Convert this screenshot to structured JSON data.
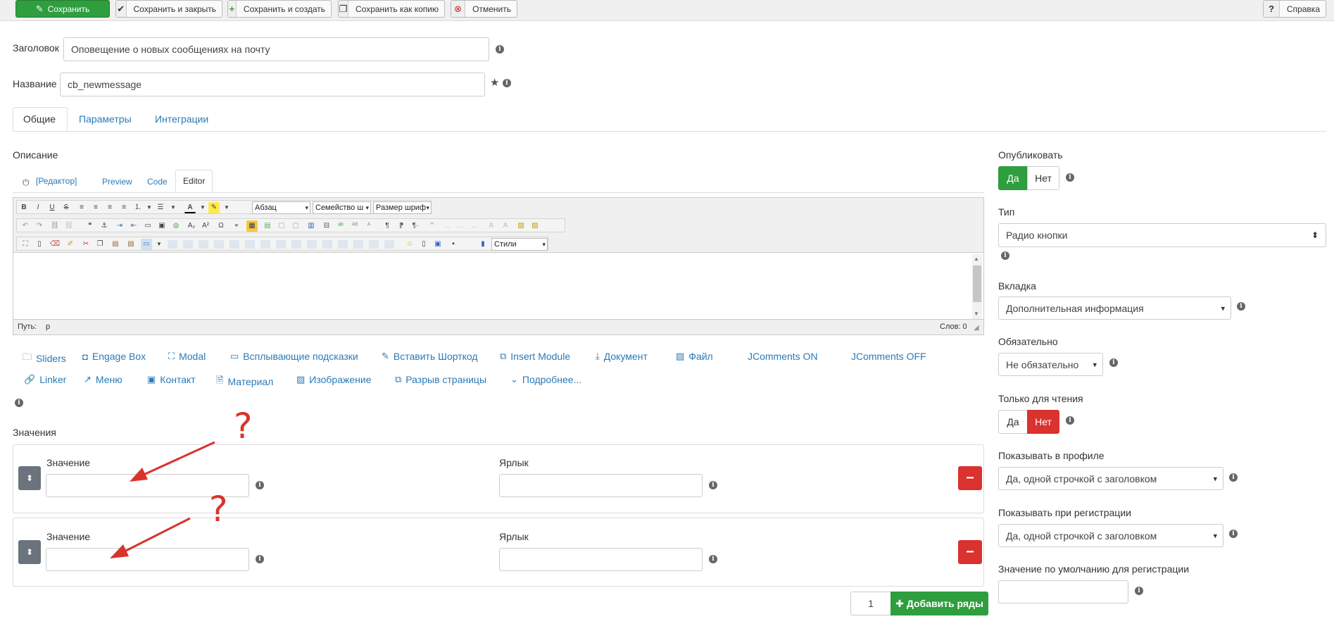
{
  "toolbar": {
    "save": "Сохранить",
    "save_close": "Сохранить и закрыть",
    "save_new": "Сохранить и создать",
    "save_copy": "Сохранить как копию",
    "cancel": "Отменить",
    "help": "Справка"
  },
  "fields": {
    "title_label": "Заголовок",
    "title_value": "Оповещение о новых сообщениях на почту",
    "name_label": "Название",
    "name_value": "cb_newmessage"
  },
  "tabs": [
    "Общие",
    "Параметры",
    "Интеграции"
  ],
  "editor": {
    "description_label": "Описание",
    "toggle_label": "[Редактор]",
    "modes": [
      "Preview",
      "Code",
      "Editor"
    ],
    "format_select": "Абзац",
    "font_family_select": "Семейство ш",
    "font_size_select": "Размер шриф",
    "styles_select": "Стили",
    "path_label": "Путь:",
    "path_value": "p",
    "word_count": "Слов: 0"
  },
  "plugin_buttons": [
    "Sliders",
    "Engage Box",
    "Modal",
    "Всплывающие подсказки",
    "Вставить Шорткод",
    "Insert Module",
    "Документ",
    "Файл",
    "JComments ON",
    "JComments OFF",
    "Linker",
    "Меню",
    "Контакт",
    "Материал",
    "Изображение",
    "Разрыв страницы",
    "Подробнее..."
  ],
  "values": {
    "section_label": "Значения",
    "value_label": "Значение",
    "label_label": "Ярлык",
    "rows": [
      {
        "value": "",
        "label": ""
      },
      {
        "value": "",
        "label": ""
      }
    ],
    "row_count": "1",
    "add_rows_button": "Добавить ряды",
    "annotation": "?"
  },
  "sidebar": {
    "publish_label": "Опубликовать",
    "yes": "Да",
    "no": "Нет",
    "type_label": "Тип",
    "type_value": "Радио кнопки",
    "tab_label": "Вкладка",
    "tab_value": "Дополнительная информация",
    "required_label": "Обязательно",
    "required_value": "Не обязательно",
    "readonly_label": "Только для чтения",
    "profile_label": "Показывать в профиле",
    "profile_value": "Да, одной строчкой с заголовком",
    "registration_label": "Показывать при регистрации",
    "registration_value": "Да, одной строчкой с заголовком",
    "default_label": "Значение по умолчанию для регистрации",
    "default_value": ""
  },
  "colors": {
    "success": "#2e9e3e",
    "danger": "#d9322f",
    "link": "#2a7ab8",
    "annotation": "#d9332c"
  }
}
